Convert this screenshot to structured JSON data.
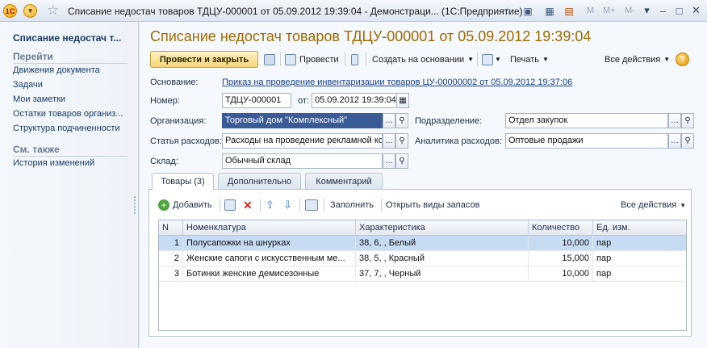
{
  "window": {
    "title": "Списание недостач товаров ТДЦУ-000001 от 05.09.2012 19:39:04 - Демонстраци... (1С:Предприятие)",
    "tb_labels": [
      "M",
      "M+",
      "M-"
    ]
  },
  "nav": {
    "title": "Списание недостач т...",
    "goto_header": "Перейти",
    "goto_items": [
      "Движения документа",
      "Задачи",
      "Мои заметки",
      "Остатки товаров организ...",
      "Структура подчиненности"
    ],
    "see_also_header": "См. также",
    "see_also_items": [
      "История изменений"
    ]
  },
  "doc": {
    "title": "Списание недостач товаров ТДЦУ-000001 от 05.09.2012 19:39:04"
  },
  "toolbar": {
    "post_close": "Провести и закрыть",
    "post": "Провести",
    "create_based": "Создать на основании",
    "print": "Печать",
    "all_actions": "Все действия"
  },
  "form": {
    "basis_label": "Основание:",
    "basis_link": "Приказ на проведение инвентаризации товаров ЦУ-00000002 от 05.09.2012 19:37:06",
    "number_label": "Номер:",
    "number_value": "ТДЦУ-000001",
    "date_label": "от:",
    "date_value": "05.09.2012 19:39:04",
    "org_label": "Организация:",
    "org_value": "Торговый дом \"Комплексный\"",
    "division_label": "Подразделение:",
    "division_value": "Отдел закупок",
    "expense_label": "Статья расходов:",
    "expense_value": "Расходы на проведение рекламной ко",
    "analytics_label": "Аналитика расходов:",
    "analytics_value": "Оптовые продажи",
    "warehouse_label": "Склад:",
    "warehouse_value": "Обычный склад"
  },
  "tabs": [
    "Товары (3)",
    "Дополнительно",
    "Комментарий"
  ],
  "table_toolbar": {
    "add": "Добавить",
    "fill": "Заполнить",
    "open_stock_types": "Открыть виды запасов",
    "all_actions": "Все действия"
  },
  "table": {
    "columns": [
      "N",
      "Номенклатура",
      "Характеристика",
      "Количество",
      "Ед. изм."
    ],
    "rows": [
      [
        "1",
        "Полусапожки на шнурках",
        "38, 6, , Белый",
        "10,000",
        "пар"
      ],
      [
        "2",
        "Женские сапоги с искусственным ме...",
        "38, 5, , Красный",
        "15,000",
        "пар"
      ],
      [
        "3",
        "Ботинки женские демисезонные",
        "37, 7, , Черный",
        "10,000",
        "пар"
      ]
    ]
  },
  "colors": {
    "title_accent": "#9c6b00",
    "primary_button": "#f5d67a",
    "selection": "#c7dcf3"
  }
}
